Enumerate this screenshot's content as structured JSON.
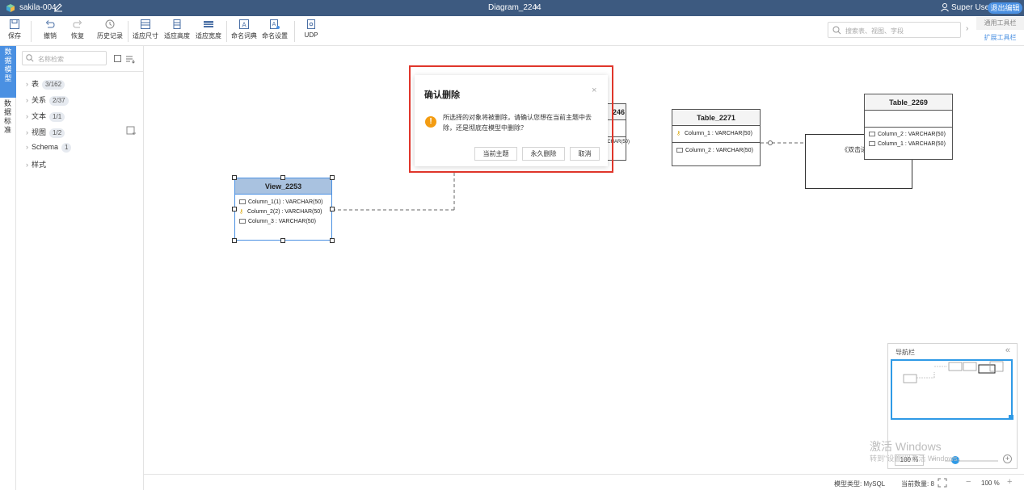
{
  "titlebar": {
    "project": "sakila-004",
    "diagram": "Diagram_2244",
    "diagram_chevron": "›",
    "user": "Super User",
    "exit_label": "退出编辑"
  },
  "toolbar": {
    "save": "保存",
    "undo": "撤销",
    "redo": "恢复",
    "history": "历史记录",
    "fit_size": "适应尺寸",
    "fit_height": "适应高度",
    "fit_width": "适应宽度",
    "naming_dict": "命名词典",
    "naming_settings": "命名设置",
    "udp": "UDP",
    "search_placeholder": "搜索表、视图、字段",
    "search_chevron": "›",
    "general_tools": "通用工具栏",
    "extended_tools": "扩展工具栏"
  },
  "left_tabs": {
    "data_model": "数据模型",
    "data_standard": "数据标准"
  },
  "tree": {
    "search_placeholder": "名称检索",
    "arrow": "›",
    "items": [
      {
        "label": "表",
        "count": "3/162"
      },
      {
        "label": "关系",
        "count": "2/37"
      },
      {
        "label": "文本",
        "count": "1/1"
      },
      {
        "label": "视图",
        "count": "1/2"
      },
      {
        "label": "Schema",
        "count": "1"
      },
      {
        "label": "样式",
        "count": ""
      }
    ]
  },
  "entities": {
    "view_2253": {
      "name": "View_2253",
      "columns": [
        "Column_1(1) : VARCHAR(50)",
        "Column_2(2) : VARCHAR(50)",
        "Column_3 : VARCHAR(50)"
      ]
    },
    "table_2246": {
      "name_fragment": "246",
      "column_fragment": "ARCHAR(50)"
    },
    "table_2271": {
      "name": "Table_2271",
      "pk_columns": [
        "Column_1 : VARCHAR(50)"
      ],
      "columns": [
        "Column_2 : VARCHAR(50)"
      ]
    },
    "table_2269": {
      "name": "Table_2269",
      "columns": [
        "Column_2 : VARCHAR(50)",
        "Column_1 : VARCHAR(50)"
      ]
    },
    "note_text": "《双击进"
  },
  "dialog": {
    "title": "确认删除",
    "close": "×",
    "message": "所选择的对象将被删除，请确认您想在当前主题中去除，还是彻底在模型中删除？",
    "btn_current_topic": "当前主题",
    "btn_delete_forever": "永久删除",
    "btn_cancel": "取消"
  },
  "navigator": {
    "title": "导航栏",
    "collapse": "«",
    "zoom": "100 %",
    "minus": "−",
    "plus": "+"
  },
  "watermark": {
    "line1": "激活 Windows",
    "line2": "转到\"设置\"以激活 Windows。"
  },
  "statusbar": {
    "model_type": "模型类型: MySQL",
    "count": "当前数量: 8",
    "minus": "−",
    "zoom": "100 %",
    "plus": "+"
  },
  "colors": {
    "titlebar": "#3d5a80",
    "accent": "#4a90e2",
    "highlight_outline": "#e0362b",
    "warning": "#f39c12"
  }
}
